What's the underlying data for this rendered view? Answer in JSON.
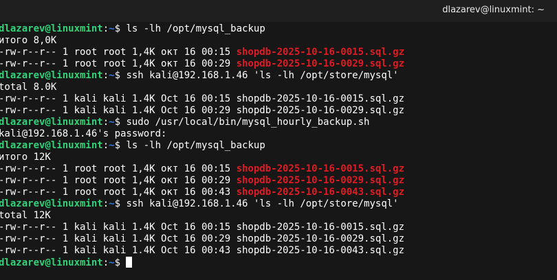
{
  "window": {
    "title": "dlazarev@linuxmint: ~"
  },
  "colors": {
    "background": "#171717",
    "prompt_user": "#33d17a",
    "archive_file": "#e01b24",
    "text": "#ffffff"
  },
  "terminal": {
    "prompt": {
      "userhost": "dlazarev@linuxmint",
      "sep": ":",
      "path": "~",
      "symbol": "$ "
    },
    "lines": [
      {
        "type": "cmd",
        "text": "ls -lh /opt/mysql_backup"
      },
      {
        "type": "out",
        "text": "итого 8,0K"
      },
      {
        "type": "file",
        "text": "-rw-r--r-- 1 root root 1,4K окт 16 00:15 ",
        "name": "shopdb-2025-10-16-0015.sql.gz"
      },
      {
        "type": "file",
        "text": "-rw-r--r-- 1 root root 1,4K окт 16 00:29 ",
        "name": "shopdb-2025-10-16-0029.sql.gz"
      },
      {
        "type": "cmd",
        "text": "ssh kali@192.168.1.46 'ls -lh /opt/store/mysql'"
      },
      {
        "type": "out",
        "text": "total 8.0K"
      },
      {
        "type": "out",
        "text": "-rw-r--r-- 1 kali kali 1.4K Oct 16 00:15 shopdb-2025-10-16-0015.sql.gz"
      },
      {
        "type": "out",
        "text": "-rw-r--r-- 1 kali kali 1.4K Oct 16 00:29 shopdb-2025-10-16-0029.sql.gz"
      },
      {
        "type": "cmd",
        "text": "sudo /usr/local/bin/mysql_hourly_backup.sh"
      },
      {
        "type": "out",
        "text": "kali@192.168.1.46's password:"
      },
      {
        "type": "cmd",
        "text": "ls -lh /opt/mysql_backup"
      },
      {
        "type": "out",
        "text": "итого 12K"
      },
      {
        "type": "file",
        "text": "-rw-r--r-- 1 root root 1,4K окт 16 00:15 ",
        "name": "shopdb-2025-10-16-0015.sql.gz"
      },
      {
        "type": "file",
        "text": "-rw-r--r-- 1 root root 1,4K окт 16 00:29 ",
        "name": "shopdb-2025-10-16-0029.sql.gz"
      },
      {
        "type": "file",
        "text": "-rw-r--r-- 1 root root 1,4K окт 16 00:43 ",
        "name": "shopdb-2025-10-16-0043.sql.gz"
      },
      {
        "type": "cmd",
        "text": "ssh kali@192.168.1.46 'ls -lh /opt/store/mysql'"
      },
      {
        "type": "out",
        "text": "total 12K"
      },
      {
        "type": "out",
        "text": "-rw-r--r-- 1 kali kali 1.4K Oct 16 00:15 shopdb-2025-10-16-0015.sql.gz"
      },
      {
        "type": "out",
        "text": "-rw-r--r-- 1 kali kali 1.4K Oct 16 00:29 shopdb-2025-10-16-0029.sql.gz"
      },
      {
        "type": "out",
        "text": "-rw-r--r-- 1 kali kali 1.4K Oct 16 00:43 shopdb-2025-10-16-0043.sql.gz"
      },
      {
        "type": "input",
        "text": ""
      }
    ]
  }
}
